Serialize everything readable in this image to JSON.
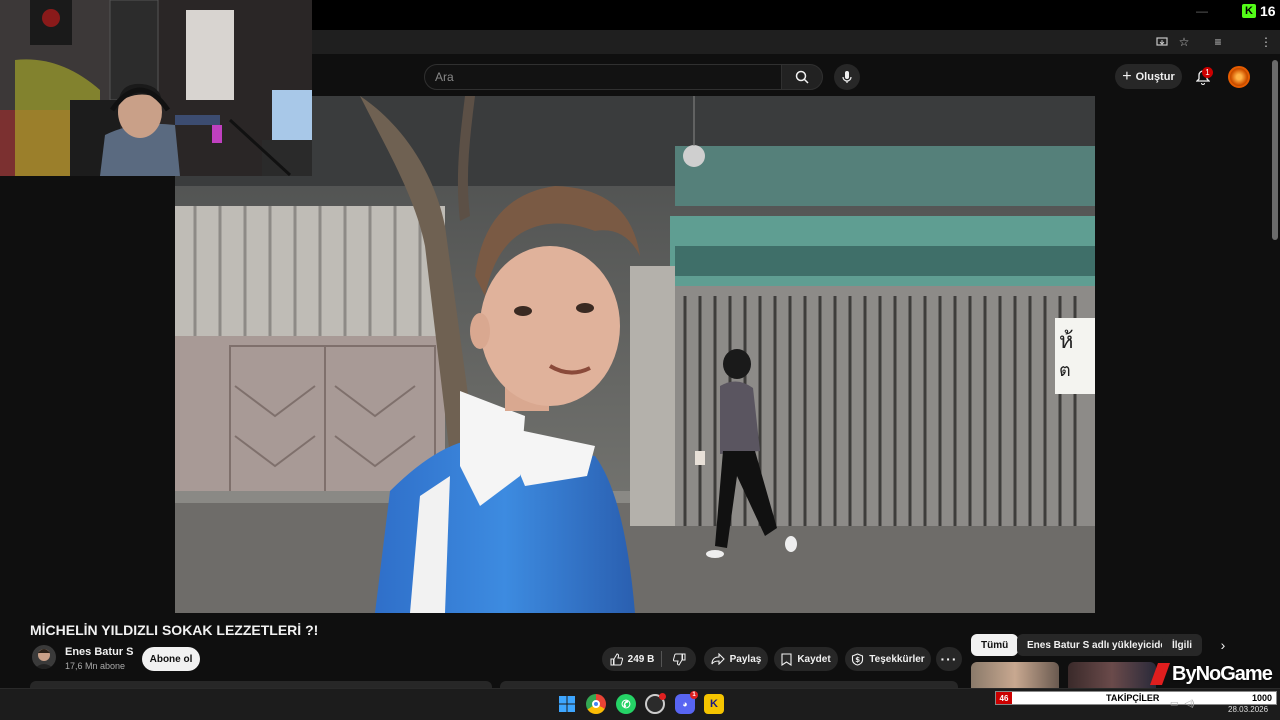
{
  "kick": {
    "count": "16"
  },
  "search": {
    "placeholder": "Ara"
  },
  "header": {
    "create_label": "Oluştur",
    "notification_count": "1"
  },
  "video": {
    "title": "MİCHELİN YILDIZLI SOKAK LEZZETLERİ ?!",
    "channel_name": "Enes Batur S",
    "subscribers": "17,6 Mn abone",
    "subscribe_label": "Abone ol",
    "like_count": "249 B",
    "share_label": "Paylaş",
    "save_label": "Kaydet",
    "thanks_label": "Teşekkürler",
    "scene_sign_text": "ห้\nต"
  },
  "chips": [
    {
      "label": "Tümü"
    },
    {
      "label": "Enes Batur S adlı yükleyiciden"
    },
    {
      "label": "İlgili"
    }
  ],
  "overlay": {
    "brand": "ByNoGame",
    "followers_label": "TAKİPÇİLER",
    "followers_current": "46",
    "followers_goal": "1000"
  },
  "taskbar": {
    "date": "28.03.2026"
  },
  "colors": {
    "background": "#0f0f0f",
    "accent_red": "#cc0000",
    "kick_green": "#53fc18",
    "chip_active_bg": "#f1f1f1"
  },
  "icons": [
    "search-icon",
    "mic-icon",
    "plus-icon",
    "bell-icon",
    "like-icon",
    "dislike-icon",
    "share-icon",
    "bookmark-icon",
    "thanks-icon",
    "more-icon",
    "chevron-right-icon"
  ]
}
